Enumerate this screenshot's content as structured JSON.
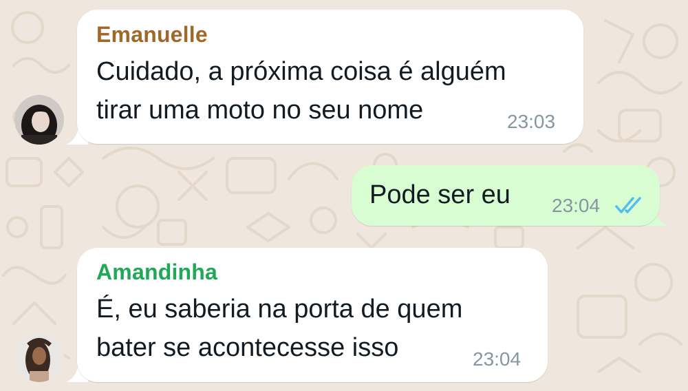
{
  "chat": {
    "messages": [
      {
        "direction": "incoming",
        "sender": "Emanuelle",
        "sender_color": "#a0692a",
        "lines": [
          "Cuidado, a próxima coisa é alguém",
          "tirar uma moto no seu nome"
        ],
        "time": "23:03",
        "avatar_icon": "contact-photo-emanuelle"
      },
      {
        "direction": "outgoing",
        "lines": [
          "Pode ser eu"
        ],
        "time": "23:04",
        "status_icon": "double-check-read-icon",
        "status_color": "#53bdeb"
      },
      {
        "direction": "incoming",
        "sender": "Amandinha",
        "sender_color": "#1fa855",
        "lines": [
          "É, eu saberia na porta de quem",
          "bater se acontecesse isso"
        ],
        "time": "23:04",
        "avatar_icon": "contact-photo-amandinha"
      }
    ]
  },
  "theme": {
    "wallpaper": "#efe7dd",
    "incoming_bubble": "#ffffff",
    "outgoing_bubble": "#d9fdd3",
    "text": "#111b21",
    "meta_text": "#8696a0"
  }
}
